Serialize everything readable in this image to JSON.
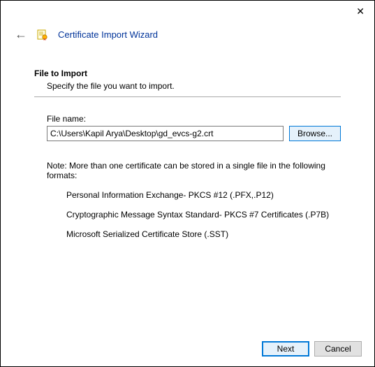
{
  "window": {
    "close_label": "✕"
  },
  "header": {
    "back_arrow": "←",
    "title": "Certificate Import Wizard"
  },
  "page": {
    "heading": "File to Import",
    "subheading": "Specify the file you want to import.",
    "file_label": "File name:",
    "file_value": "C:\\Users\\Kapil Arya\\Desktop\\gd_evcs-g2.crt",
    "browse_label": "Browse...",
    "note": "Note:  More than one certificate can be stored in a single file in the following formats:",
    "formats": [
      "Personal Information Exchange- PKCS #12 (.PFX,.P12)",
      "Cryptographic Message Syntax Standard- PKCS #7 Certificates (.P7B)",
      "Microsoft Serialized Certificate Store (.SST)"
    ]
  },
  "footer": {
    "next_label": "Next",
    "cancel_label": "Cancel"
  }
}
